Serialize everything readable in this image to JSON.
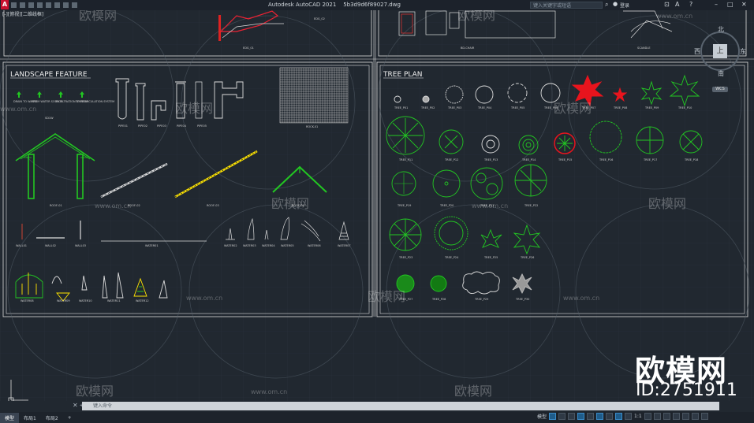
{
  "titlebar": {
    "app_title": "Autodesk AutoCAD 2021",
    "file_name": "5b3d9d6f89027.dwg",
    "search_placeholder": "键入关键字或短语",
    "sign_in": "登录",
    "logo_letter": "A"
  },
  "viewport_label": "[-][俯视][二维线框]",
  "viewcube": {
    "north": "北",
    "south": "南",
    "west": "西",
    "east": "东",
    "face": "上",
    "wcs": "WCS"
  },
  "panels": {
    "landscape": {
      "title": "LANDSCAPE FEATURE",
      "labels": [
        "SD1W",
        "PIPE01",
        "PIPE02",
        "PIPE03",
        "PIPE04",
        "PIPE05",
        "ROOF-01",
        "ROOF-02",
        "ROOF-03",
        "ROOF-04",
        "ROCK-01",
        "WALL01",
        "WALL02",
        "WALL03",
        "WATER01",
        "WATER02",
        "WATER03",
        "WATER04",
        "WATER05",
        "WATER06",
        "WATER07",
        "WATER08",
        "WATER09",
        "WATER10",
        "WATER11",
        "WATER12"
      ],
      "flow_notes": [
        "DRAIN TO WASTE",
        "FROM WATER SOURCE",
        "TO FILTRATION SYSTEM",
        "TO RECIRCULATION SYSTEM"
      ]
    },
    "tree": {
      "title": "TREE PLAN",
      "labels": [
        "TREE_P01",
        "TREE_P02",
        "TREE_P03",
        "TREE_P04",
        "TREE_P05",
        "TREE_P06",
        "TREE_P07",
        "TREE_P08",
        "TREE_P09",
        "TREE_P10",
        "TREE_P11",
        "TREE_P12",
        "TREE_P13",
        "TREE_P14",
        "TREE_P15",
        "TREE_P16",
        "TREE_P17",
        "TREE_P18",
        "TREE_P19",
        "TREE_P20",
        "TREE_P21",
        "TREE_P22",
        "TREE_P23",
        "TREE_P24",
        "TREE_P25",
        "TREE_P26",
        "TREE_P27",
        "TREE_P28",
        "TREE_P29",
        "TREE_P30"
      ]
    },
    "top_left_labels": [
      "EDG_02",
      "EDG_01"
    ],
    "top_right_labels": [
      "BD-CHAIR",
      "SCANDLE"
    ]
  },
  "watermark": {
    "brand": "欧模网",
    "url": "www.om.cn",
    "id": "ID:2751911"
  },
  "command": {
    "placeholder": "键入命令"
  },
  "layout_tabs": [
    "模型",
    "布局1",
    "布局2"
  ],
  "status": {
    "model": "模型",
    "scale": "1:1"
  },
  "colors": {
    "background": "#212830",
    "lines": "#e6e6e6",
    "green": "#22c722",
    "red": "#e8141d",
    "yellow": "#ffe400"
  }
}
